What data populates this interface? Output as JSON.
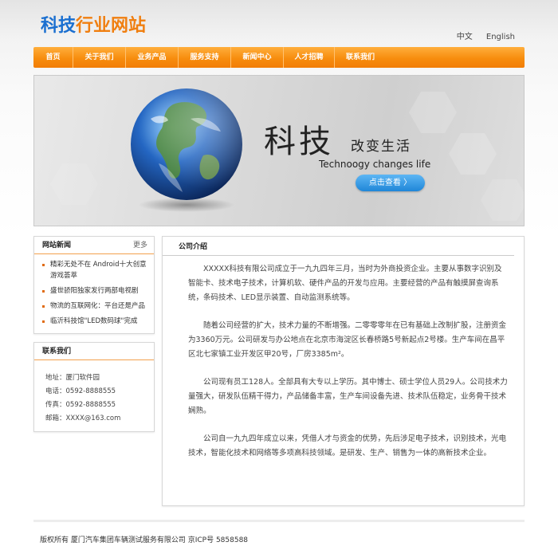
{
  "logo": {
    "part1": "科技",
    "part2": "行业网站"
  },
  "langs": [
    "中文",
    "English"
  ],
  "nav": [
    "首页",
    "关于我们",
    "业务产品",
    "服务支持",
    "新闻中心",
    "人才招聘",
    "联系我们"
  ],
  "banner": {
    "title": "科技",
    "subtitle": "改变生活",
    "english": "Technoogy changes life",
    "button": "点击查看 〉"
  },
  "news": {
    "title": "网站新闻",
    "more": "更多",
    "items": [
      "精彩无处不在 Android十大创意游戏荟萃",
      "盛世骄阳独家发行两部电视剧",
      "物流的互联网化：平台还是产品",
      "临沂科技馆\"LED数码球\"完成"
    ]
  },
  "contact": {
    "title": "联系我们",
    "rows": [
      {
        "label": "地址：",
        "value": "厦门软件园"
      },
      {
        "label": "电话：",
        "value": "0592-8888555"
      },
      {
        "label": "传真：",
        "value": "0592-8888555"
      },
      {
        "label": "邮箱：",
        "value": "XXXX@163.com"
      }
    ]
  },
  "about": {
    "title": "公司介绍",
    "paragraphs": [
      "XXXXX科技有限公司成立于一九九四年三月，当时为外商投资企业。主要从事数字识别及智能卡、技术电子技术，计算机软、硬件产品的开发与应用。主要经营的产品有触摸屏查询系统，条码技术、LED显示装置、自动监测系统等。",
      "随着公司经营的扩大，技术力量的不断增强。二零零零年在已有基础上改制扩股，注册资金为3360万元。公司研发与办公地点在北京市海淀区长春桥路5号新起点2号楼。生产车间在昌平区北七家镇工业开发区甲20号，厂房3385m²。",
      "公司现有员工128人。全部具有大专以上学历。其中博士、硕士学位人员29人。公司技术力量强大，研发队伍精干得力，产品储备丰富，生产车间设备先进、技术队伍稳定，业务骨干技术娴熟。",
      "公司自一九九四年成立以来，凭借人才与资金的优势，先后涉足电子技术，识别技术，光电技术，智能化技术和网络等多项高科技领域。是研发、生产、销售为一体的高新技术企业。"
    ]
  },
  "footer": "版权所有 厦门汽车集团车辆测试服务有限公司  京ICP号 5858588",
  "colors": {
    "accent": "#f78d0e",
    "logo_blue": "#1a6fd0",
    "button_blue": "#2a8fe0"
  }
}
